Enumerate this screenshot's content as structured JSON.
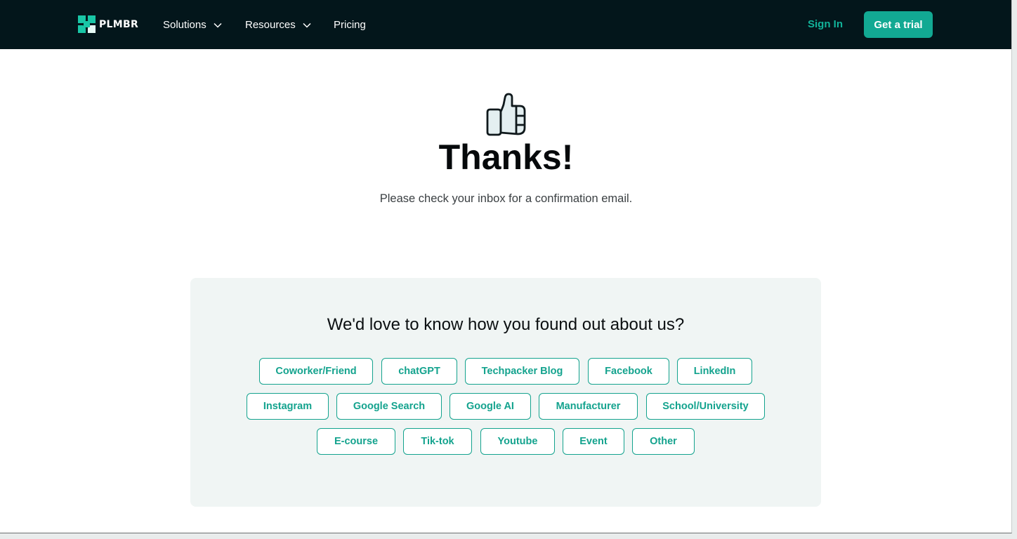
{
  "nav": {
    "logo_text": "PLMBR",
    "items": [
      {
        "label": "Solutions",
        "has_dropdown": true
      },
      {
        "label": "Resources",
        "has_dropdown": true
      },
      {
        "label": "Pricing",
        "has_dropdown": false
      }
    ],
    "sign_in": "Sign In",
    "trial_button": "Get a trial"
  },
  "hero": {
    "icon": "thumbs-up-icon",
    "title": "Thanks!",
    "subtitle": "Please check your inbox for a confirmation email."
  },
  "survey": {
    "question": "We'd love to know how you found out about us?",
    "options": [
      [
        "Coworker/Friend",
        "chatGPT",
        "Techpacker Blog",
        "Facebook",
        "LinkedIn"
      ],
      [
        "Instagram",
        "Google Search",
        "Google AI",
        "Manufacturer",
        "School/University"
      ],
      [
        "E-course",
        "Tik-tok",
        "Youtube",
        "Event",
        "Other"
      ]
    ]
  },
  "colors": {
    "nav_bg": "#03161b",
    "accent": "#12a993",
    "card_bg": "#f0f5f4"
  }
}
